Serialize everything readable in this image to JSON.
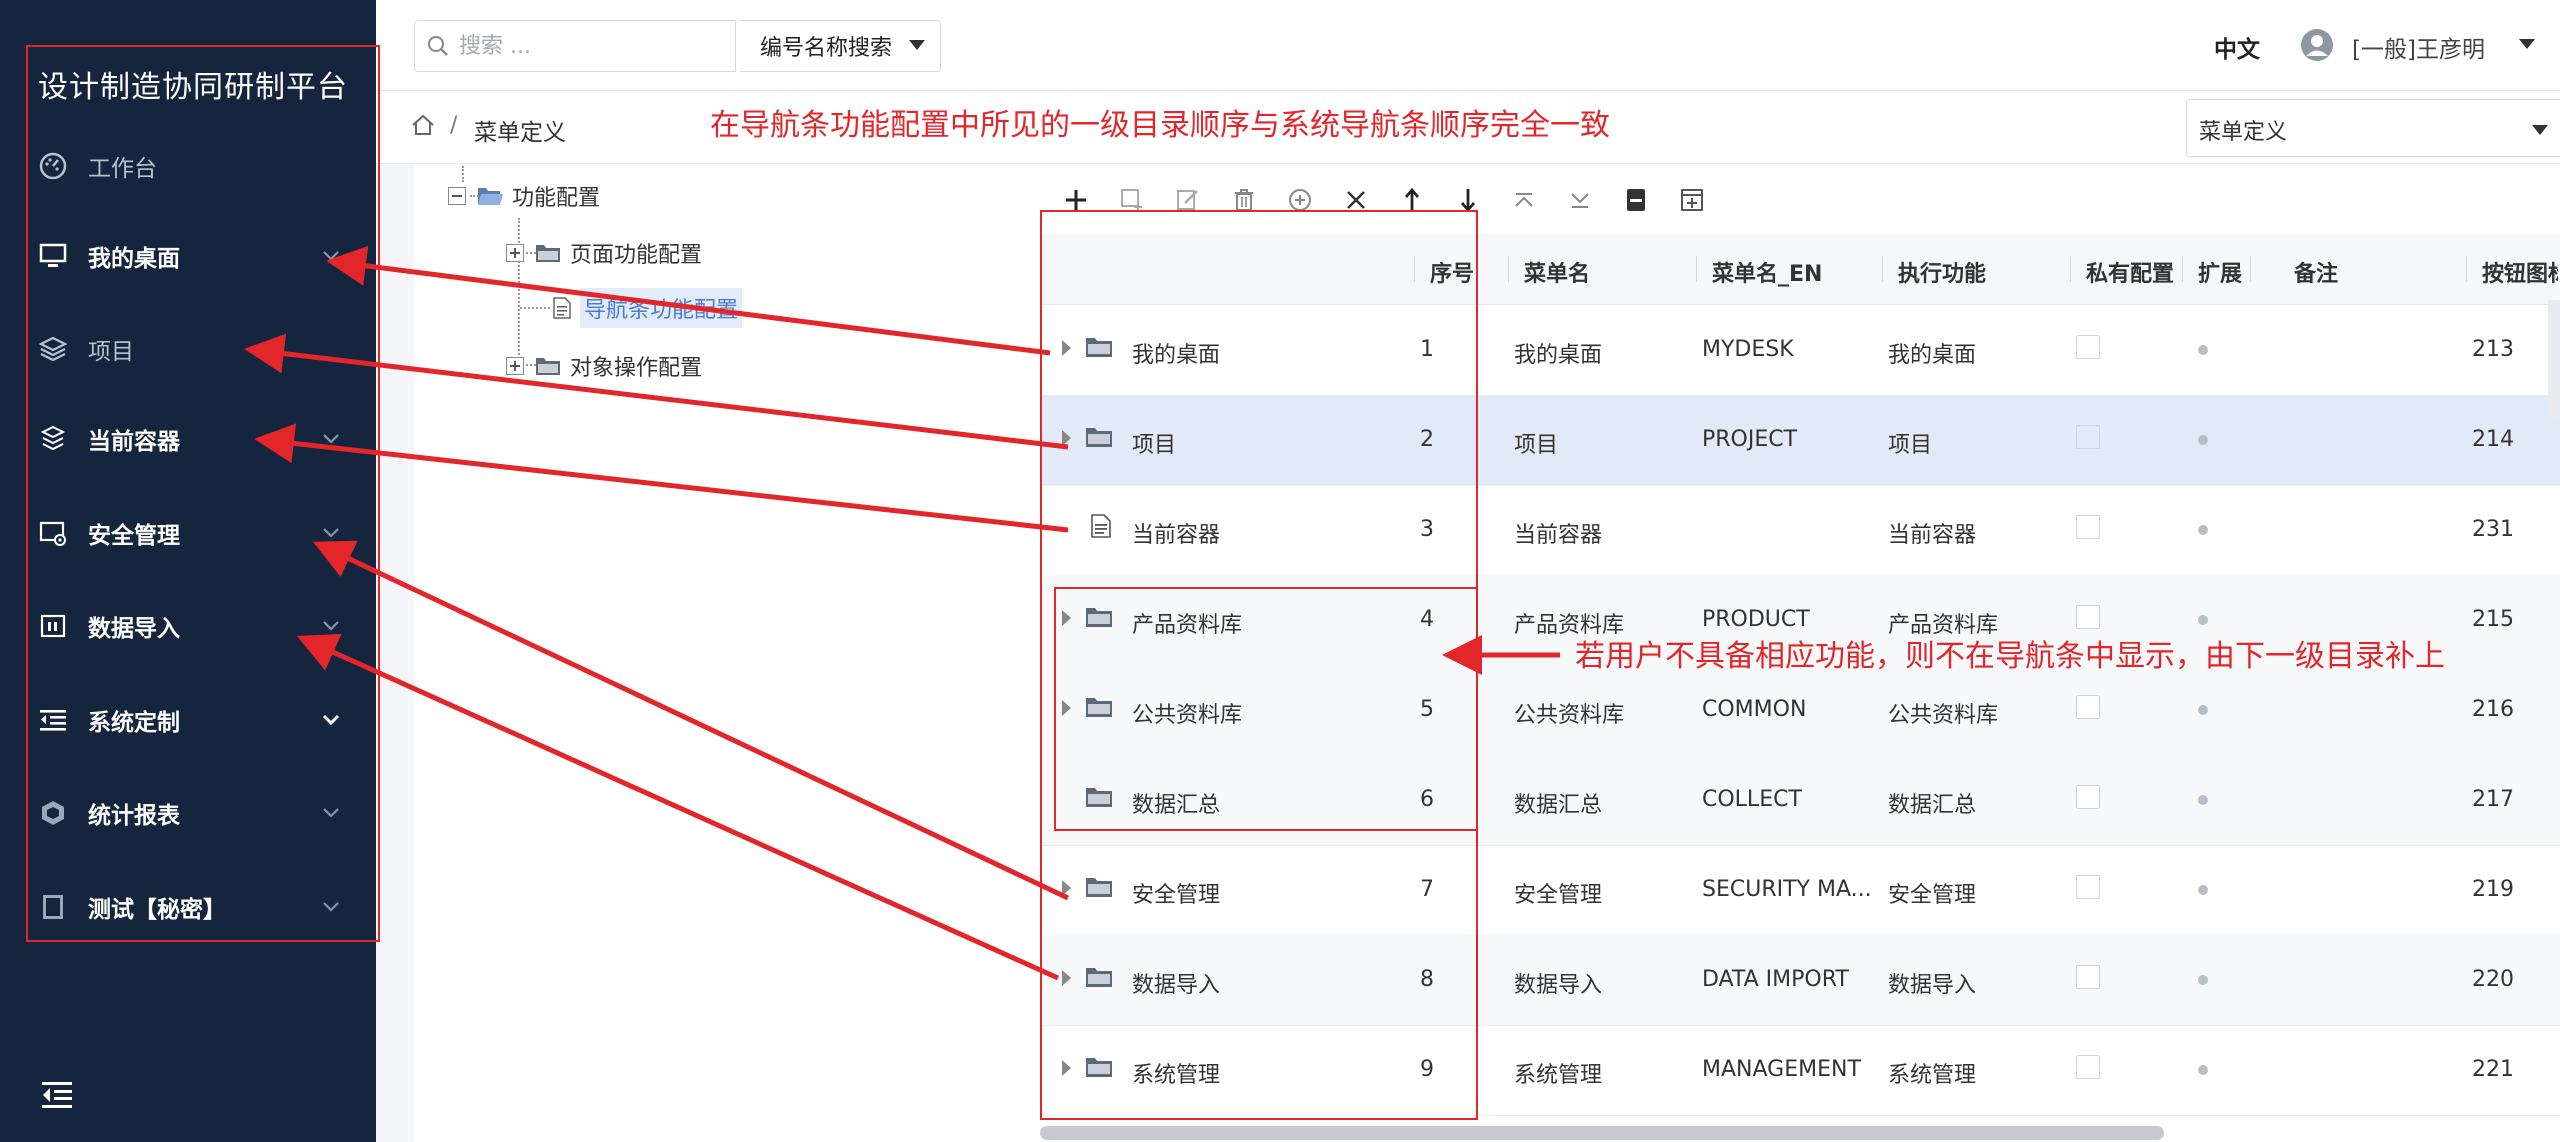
{
  "sidebar": {
    "app_title": "设计制造协同研制平台",
    "items": [
      {
        "label": "工作台",
        "icon": "dashboard-icon",
        "has_chevron": false
      },
      {
        "label": "我的桌面",
        "icon": "monitor-icon",
        "has_chevron": true
      },
      {
        "label": "项目",
        "icon": "layers-icon",
        "has_chevron": false
      },
      {
        "label": "当前容器",
        "icon": "boxes-icon",
        "has_chevron": true
      },
      {
        "label": "安全管理",
        "icon": "security-gear-icon",
        "has_chevron": true
      },
      {
        "label": "数据导入",
        "icon": "import-icon",
        "has_chevron": true
      },
      {
        "label": "系统定制",
        "icon": "list-indent-icon",
        "has_chevron": true
      },
      {
        "label": "统计报表",
        "icon": "hexagon-icon",
        "has_chevron": true
      },
      {
        "label": "测试【秘密】",
        "icon": "document-icon",
        "has_chevron": true
      }
    ]
  },
  "topbar": {
    "search_placeholder": "搜索 ...",
    "search_mode": "编号名称搜索",
    "language": "中文",
    "user": "[一般]王彦明"
  },
  "breadcrumb": {
    "page": "菜单定义",
    "page_select": "菜单定义"
  },
  "tree": {
    "root": "功能配置",
    "children": [
      "页面功能配置",
      "导航条功能配置",
      "对象操作配置"
    ]
  },
  "grid": {
    "columns": [
      "序号",
      "菜单名",
      "菜单名_EN",
      "执行功能",
      "私有配置",
      "扩展",
      "备注",
      "按钮图标"
    ],
    "rows": [
      {
        "name": "我的桌面",
        "seq": "1",
        "menu": "我的桌面",
        "en": "MYDESK",
        "func": "我的桌面",
        "icon_no": "213"
      },
      {
        "name": "项目",
        "seq": "2",
        "menu": "项目",
        "en": "PROJECT",
        "func": "项目",
        "icon_no": "214"
      },
      {
        "name": "当前容器",
        "seq": "3",
        "menu": "当前容器",
        "en": "",
        "func": "当前容器",
        "icon_no": "231"
      },
      {
        "name": "产品资料库",
        "seq": "4",
        "menu": "产品资料库",
        "en": "PRODUCT",
        "func": "产品资料库",
        "icon_no": "215"
      },
      {
        "name": "公共资料库",
        "seq": "5",
        "menu": "公共资料库",
        "en": "COMMON",
        "func": "公共资料库",
        "icon_no": "216"
      },
      {
        "name": "数据汇总",
        "seq": "6",
        "menu": "数据汇总",
        "en": "COLLECT",
        "func": "数据汇总",
        "icon_no": "217"
      },
      {
        "name": "安全管理",
        "seq": "7",
        "menu": "安全管理",
        "en": "SECURITY MA...",
        "func": "安全管理",
        "icon_no": "219"
      },
      {
        "name": "数据导入",
        "seq": "8",
        "menu": "数据导入",
        "en": "DATA IMPORT",
        "func": "数据导入",
        "icon_no": "220"
      },
      {
        "name": "系统管理",
        "seq": "9",
        "menu": "系统管理",
        "en": "MANAGEMENT",
        "func": "系统管理",
        "icon_no": "221"
      }
    ]
  },
  "annotations": {
    "top_note": "在导航条功能配置中所见的一级目录顺序与系统导航条顺序完全一致",
    "side_note": "若用户不具备相应功能，则不在导航条中显示，由下一级目录补上"
  },
  "colors": {
    "sidebar_bg": "#16253e",
    "annotation_red": "#e3262a",
    "selected_row": "#e2e9f7"
  }
}
